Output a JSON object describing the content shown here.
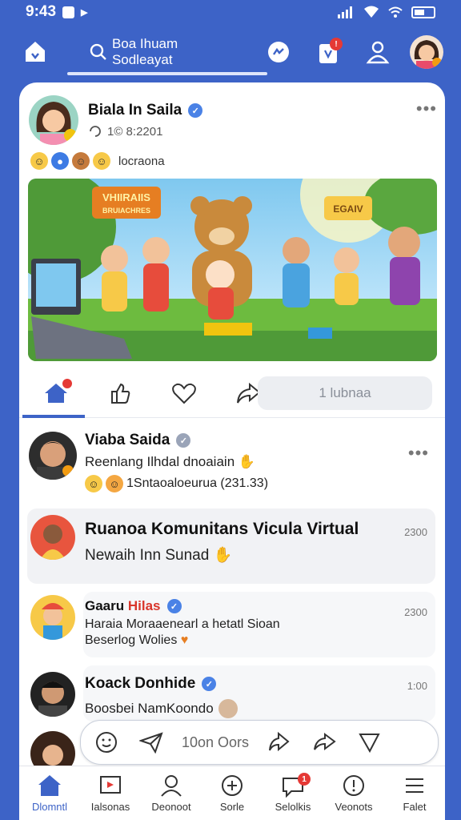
{
  "status_bar": {
    "time": "9:43"
  },
  "top_nav": {
    "search_placeholder": "Boa Ihuam Sodleayat"
  },
  "post": {
    "author": "Biala In Saila",
    "meta": "1© 8:2201",
    "reaction_text": "locraona"
  },
  "post_image_text": {
    "banner_left": "VHIIRAIIS",
    "banner_left_sub": "BRUIACHRES",
    "banner_right": "EGAIV"
  },
  "action_bar": {
    "comment_placeholder": "1 lubnaa"
  },
  "feed": [
    {
      "name": "Viaba Saida",
      "text": "Reenlang Ilhdal dnoaiain",
      "subtext": "1Sntaoaloeurua (231.33)",
      "time": ""
    },
    {
      "name": "Ruanoa Komunitans Vicula Virtual",
      "text": "Newaih Inn Sunad",
      "time": "2300"
    },
    {
      "name_part1": "Gaaru ",
      "name_part2": "Hilas",
      "text": "Haraia Moraaenearl a hetatl Sioan",
      "text2": "Beserlog Wolies",
      "time": "2300"
    },
    {
      "name": "Koack Donhide",
      "text": "Boosbei NamKoondo",
      "time": "1:00"
    }
  ],
  "float_bar": {
    "text": "10on Oors"
  },
  "bottom_nav": [
    {
      "label": "Dlomntl"
    },
    {
      "label": "Ialsonas"
    },
    {
      "label": "Deonoot"
    },
    {
      "label": "Sorle"
    },
    {
      "label": "Selolkis",
      "badge": "1"
    },
    {
      "label": "Veonots"
    },
    {
      "label": "Falet"
    }
  ]
}
